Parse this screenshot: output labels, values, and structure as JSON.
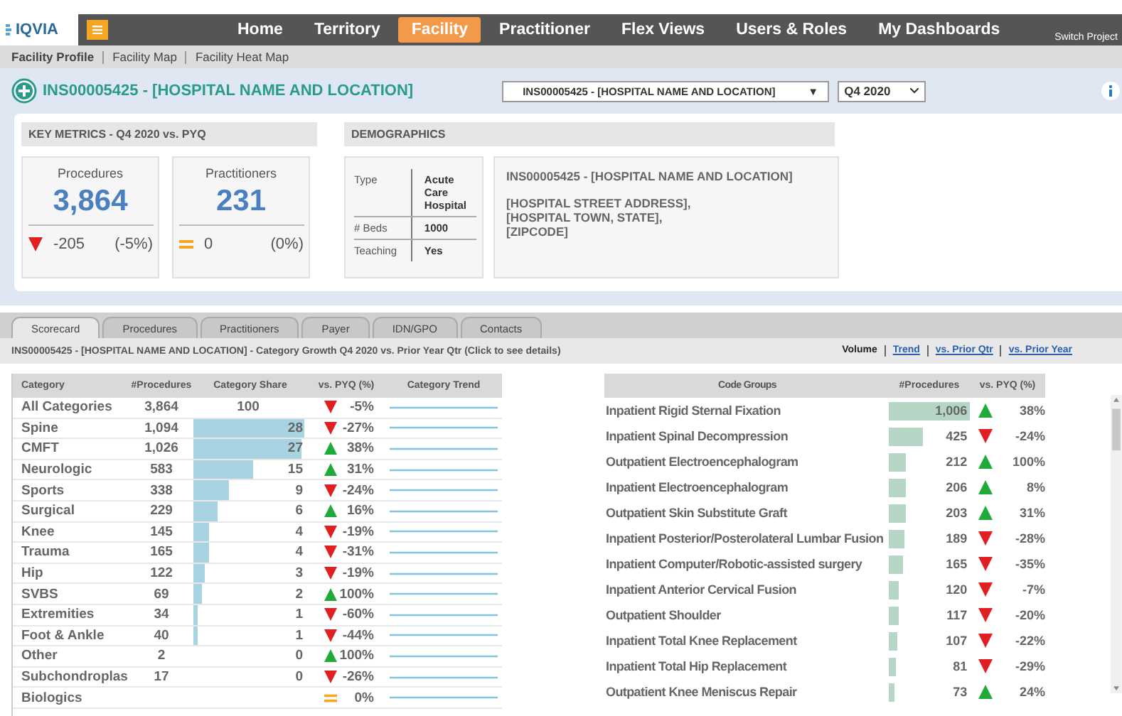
{
  "nav": {
    "logo": "IQVIA",
    "items": [
      {
        "label": "Home",
        "selected": false
      },
      {
        "label": "Territory",
        "selected": false
      },
      {
        "label": "Facility",
        "selected": true
      },
      {
        "label": "Practitioner",
        "selected": false
      },
      {
        "label": "Flex Views",
        "selected": false
      },
      {
        "label": "Users & Roles",
        "selected": false
      },
      {
        "label": "My Dashboards",
        "selected": false
      }
    ],
    "switch_project": "Switch Project"
  },
  "subnav": [
    {
      "label": "Facility Profile",
      "selected": true
    },
    {
      "label": "Facility Map",
      "selected": false
    },
    {
      "label": "Facility Heat Map",
      "selected": false
    }
  ],
  "header": {
    "title": "INS00005425 - [HOSPITAL NAME AND LOCATION]",
    "facility_select": "INS00005425 - [HOSPITAL NAME AND LOCATION]",
    "facility_caret": "▼",
    "quarter_select": "Q4 2020"
  },
  "key_metrics": {
    "title": "KEY METRICS - Q4 2020 vs. PYQ",
    "cards": [
      {
        "label": "Procedures",
        "value": "3,864",
        "kind": "down",
        "change": "-205",
        "percent": "(-5%)"
      },
      {
        "label": "Practitioners",
        "value": "231",
        "kind": "flat",
        "change": "0",
        "percent": "(0%)"
      }
    ]
  },
  "demographics": {
    "title": "DEMOGRAPHICS",
    "rows": [
      {
        "label": "Type",
        "value": "Acute Care Hospital"
      },
      {
        "label": "# Beds",
        "value": "1000"
      },
      {
        "label": "Teaching",
        "value": "Yes"
      }
    ],
    "address": {
      "name": "INS00005425 - [HOSPITAL NAME AND LOCATION]",
      "lines": [
        "[HOSPITAL STREET ADDRESS],",
        "[HOSPITAL TOWN, STATE],",
        "[ZIPCODE]"
      ]
    }
  },
  "tabs": [
    {
      "label": "Scorecard",
      "selected": true
    },
    {
      "label": "Procedures",
      "selected": false
    },
    {
      "label": "Practitioners",
      "selected": false
    },
    {
      "label": "Payer",
      "selected": false
    },
    {
      "label": "IDN/GPO",
      "selected": false
    },
    {
      "label": "Contacts",
      "selected": false
    }
  ],
  "subtitle": "INS00005425 - [HOSPITAL NAME AND LOCATION] - Category Growth Q4 2020 vs. Prior Year Qtr (Click to see details)",
  "views": [
    {
      "label": "Volume",
      "selected": true
    },
    {
      "label": "Trend",
      "selected": false
    },
    {
      "label": "vs. Prior Qtr",
      "selected": false
    },
    {
      "label": "vs. Prior Year",
      "selected": false
    }
  ],
  "category_table": {
    "columns": [
      "Category",
      "#Procedures",
      "Category Share",
      "vs. PYQ (%)",
      "Category Trend"
    ],
    "rows": [
      {
        "category": "All Categories",
        "procedures": "3,864",
        "share": "100",
        "kind": "down",
        "pyq": "-5%"
      },
      {
        "category": "Spine",
        "procedures": "1,094",
        "share": "28",
        "kind": "down",
        "pyq": "-27%"
      },
      {
        "category": "CMFT",
        "procedures": "1,026",
        "share": "27",
        "kind": "up",
        "pyq": "38%"
      },
      {
        "category": "Neurologic",
        "procedures": "583",
        "share": "15",
        "kind": "up",
        "pyq": "31%"
      },
      {
        "category": "Sports",
        "procedures": "338",
        "share": "9",
        "kind": "down",
        "pyq": "-24%"
      },
      {
        "category": "Surgical",
        "procedures": "229",
        "share": "6",
        "kind": "up",
        "pyq": "16%"
      },
      {
        "category": "Knee",
        "procedures": "145",
        "share": "4",
        "kind": "down",
        "pyq": "-19%"
      },
      {
        "category": "Trauma",
        "procedures": "165",
        "share": "4",
        "kind": "down",
        "pyq": "-31%"
      },
      {
        "category": "Hip",
        "procedures": "122",
        "share": "3",
        "kind": "down",
        "pyq": "-19%"
      },
      {
        "category": "SVBS",
        "procedures": "69",
        "share": "2",
        "kind": "up",
        "pyq": "100%"
      },
      {
        "category": "Extremities",
        "procedures": "34",
        "share": "1",
        "kind": "down",
        "pyq": "-60%"
      },
      {
        "category": "Foot & Ankle",
        "procedures": "40",
        "share": "1",
        "kind": "down",
        "pyq": "-44%"
      },
      {
        "category": "Other",
        "procedures": "2",
        "share": "0",
        "kind": "up",
        "pyq": "100%"
      },
      {
        "category": "Subchondroplas",
        "procedures": "17",
        "share": "0",
        "kind": "down",
        "pyq": "-26%"
      },
      {
        "category": "Biologics",
        "kind": "flat",
        "pyq": "0%"
      }
    ]
  },
  "code_table": {
    "columns": [
      "Code Groups",
      "#Procedures",
      "vs. PYQ (%)"
    ],
    "rows": [
      {
        "group": "Inpatient Rigid Sternal Fixation",
        "procedures": "1,006",
        "kind": "up",
        "pyq": "38%"
      },
      {
        "group": "Inpatient Spinal Decompression",
        "procedures": "425",
        "kind": "down",
        "pyq": "-24%"
      },
      {
        "group": "Outpatient Electroencephalogram",
        "procedures": "212",
        "kind": "up",
        "pyq": "100%"
      },
      {
        "group": "Inpatient Electroencephalogram",
        "procedures": "206",
        "kind": "up",
        "pyq": "8%"
      },
      {
        "group": "Outpatient Skin Substitute Graft",
        "procedures": "203",
        "kind": "up",
        "pyq": "31%"
      },
      {
        "group": "Inpatient Posterior/Posterolateral Lumbar Fusion",
        "procedures": "189",
        "kind": "down",
        "pyq": "-28%"
      },
      {
        "group": "Inpatient Computer/Robotic-assisted surgery",
        "procedures": "165",
        "kind": "down",
        "pyq": "-35%"
      },
      {
        "group": "Inpatient Anterior Cervical Fusion",
        "procedures": "120",
        "kind": "down",
        "pyq": "-7%"
      },
      {
        "group": "Outpatient Shoulder",
        "procedures": "117",
        "kind": "down",
        "pyq": "-20%"
      },
      {
        "group": "Inpatient Total Knee Replacement",
        "procedures": "107",
        "kind": "down",
        "pyq": "-22%"
      },
      {
        "group": "Inpatient Total Hip Replacement",
        "procedures": "81",
        "kind": "down",
        "pyq": "-29%"
      },
      {
        "group": "Outpatient Knee Meniscus Repair",
        "procedures": "73",
        "kind": "up",
        "pyq": "24%"
      }
    ]
  }
}
